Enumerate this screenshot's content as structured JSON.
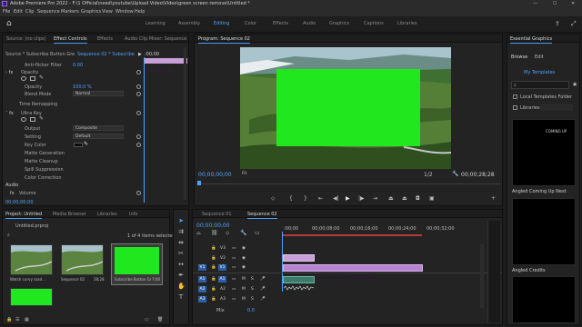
{
  "app": {
    "title": "Adobe Premiere Pro 2022 - F:\\1 Official\\need\\youtube\\Upload Video\\Video\\green screen remove\\Untitled *",
    "menus": [
      "File",
      "Edit",
      "Clip",
      "Sequence",
      "Markers",
      "Graphics",
      "View",
      "Window",
      "Help"
    ],
    "window_controls": [
      "—",
      "☐",
      "✕"
    ]
  },
  "workspaces": {
    "tabs": [
      "Learning",
      "Assembly",
      "Editing",
      "Color",
      "Effects",
      "Audio",
      "Graphics",
      "Captions",
      "Libraries"
    ],
    "active": "Editing"
  },
  "effect_controls": {
    "tabs": [
      "Source: (no clips)",
      "Effect Controls",
      "Effects",
      "Audio Clip Mixer: Sequence"
    ],
    "active_tab": "Effect Controls",
    "source_label": "Source * Subscribe Button Gre...",
    "sequence_label": "Sequence 02 * Subscribe Bu...",
    "ruler_time": ":00;00",
    "clip_bar": "Subscribe Bu",
    "rows": {
      "anti_flicker": "Anti-flicker Filter",
      "anti_flicker_val": "0.00",
      "opacity_header": "Opacity",
      "opacity": "Opacity",
      "opacity_val": "100.0 %",
      "blend_mode": "Blend Mode",
      "blend_mode_val": "Normal",
      "time_remapping": "Time Remapping",
      "ultra_key": "Ultra Key",
      "output": "Output",
      "output_val": "Composite",
      "setting": "Setting",
      "setting_val": "Default",
      "key_color": "Key Color",
      "matte_generation": "Matte Generation",
      "matte_cleanup": "Matte Cleanup",
      "spill_suppression": "Spill Suppression",
      "color_correction": "Color Correction",
      "audio": "Audio",
      "volume": "Volume"
    },
    "timecode": "00;00;00;00"
  },
  "program_monitor": {
    "title": "Program: Sequence 02",
    "timecode_left": "00;00;00;00",
    "fit": "Fit",
    "page": "1/2",
    "timecode_right": "00;00;28;28",
    "green_color": "#21e71e"
  },
  "project": {
    "tabs": [
      "Project: Untitled",
      "Media Browser",
      "Libraries",
      "Info"
    ],
    "project_file": "Untitled.prproj",
    "items_selected": "1 of 4 items selected",
    "clips": [
      {
        "name": "Watch curvy road...",
        "dur": ""
      },
      {
        "name": "Sequence 02",
        "dur": "28;28"
      },
      {
        "name": "Subscribe Button Gre...",
        "dur": "7;00"
      }
    ]
  },
  "timeline": {
    "tabs": [
      "Sequence 01",
      "Sequence 02"
    ],
    "active_tab": "Sequence 02",
    "timecode": "00;00;00;00",
    "ruler": [
      ":00;00",
      "00;00;08;00",
      "00;00;16;00",
      "00;00;24;00",
      "00;00;32;00"
    ],
    "tracks": {
      "v3": "V3",
      "v2": "V2",
      "v1": "V1",
      "a1": "A1",
      "a2": "A2",
      "a3": "A3"
    },
    "clip_v2": "Subscribe Bu",
    "clip_v1": "Watch curvy road on a hike (scaled) 40-4207.mp4",
    "mix": "Mix",
    "mix_val": "0.0"
  },
  "essential_graphics": {
    "title": "Essential Graphics",
    "tabs": [
      "Browse",
      "Edit"
    ],
    "active_tab": "Browse",
    "my_templates": "My Templates",
    "local_templates": "Local Templates Folder",
    "libraries": "Libraries",
    "templates": [
      "COMING UP",
      "Angled Coming Up Next",
      "Angled Credits"
    ]
  }
}
